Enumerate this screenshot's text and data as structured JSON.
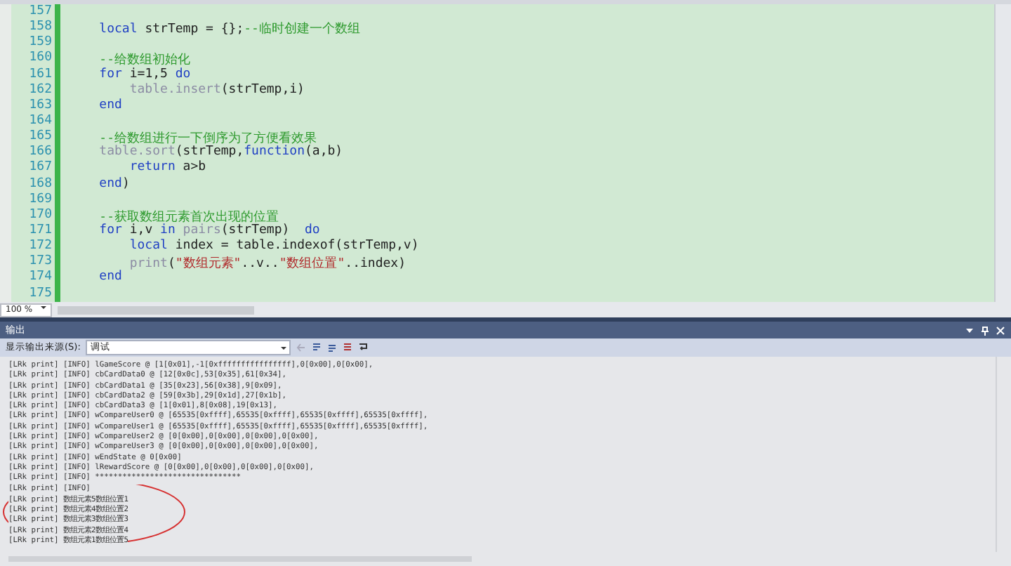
{
  "editor": {
    "lines": [
      {
        "number": "157"
      },
      {
        "number": "158",
        "tokens": [
          {
            "kind": "kw",
            "text": "    local"
          },
          {
            "kind": "plain",
            "text": " strTemp = {};"
          },
          {
            "kind": "comment",
            "text": "--临时创建一个数组"
          }
        ]
      },
      {
        "number": "159"
      },
      {
        "number": "160",
        "tokens": [
          {
            "kind": "comment",
            "text": "    --给数组初始化"
          }
        ]
      },
      {
        "number": "161",
        "tokens": [
          {
            "kind": "kw",
            "text": "    for"
          },
          {
            "kind": "plain",
            "text": " i=1,5 "
          },
          {
            "kind": "kw",
            "text": "do"
          }
        ]
      },
      {
        "number": "162",
        "tokens": [
          {
            "kind": "lib",
            "text": "        table.insert"
          },
          {
            "kind": "plain",
            "text": "(strTemp,i)"
          }
        ]
      },
      {
        "number": "163",
        "tokens": [
          {
            "kind": "kw",
            "text": "    end"
          }
        ]
      },
      {
        "number": "164"
      },
      {
        "number": "165",
        "tokens": [
          {
            "kind": "comment",
            "text": "    --给数组进行一下倒序为了方便看效果"
          }
        ]
      },
      {
        "number": "166",
        "tokens": [
          {
            "kind": "lib",
            "text": "    table.sort"
          },
          {
            "kind": "plain",
            "text": "(strTemp,"
          },
          {
            "kind": "kw",
            "text": "function"
          },
          {
            "kind": "plain",
            "text": "(a,b)"
          }
        ]
      },
      {
        "number": "167",
        "tokens": [
          {
            "kind": "kw",
            "text": "        return"
          },
          {
            "kind": "plain",
            "text": " a>b"
          }
        ]
      },
      {
        "number": "168",
        "tokens": [
          {
            "kind": "kw",
            "text": "    end"
          },
          {
            "kind": "plain",
            "text": ")"
          }
        ]
      },
      {
        "number": "169"
      },
      {
        "number": "170",
        "tokens": [
          {
            "kind": "comment",
            "text": "    --获取数组元素首次出现的位置"
          }
        ]
      },
      {
        "number": "171",
        "tokens": [
          {
            "kind": "kw",
            "text": "    for"
          },
          {
            "kind": "plain",
            "text": " i,v "
          },
          {
            "kind": "kw",
            "text": "in"
          },
          {
            "kind": "lib",
            "text": " pairs"
          },
          {
            "kind": "plain",
            "text": "(strTemp)  "
          },
          {
            "kind": "kw",
            "text": "do"
          }
        ]
      },
      {
        "number": "172",
        "tokens": [
          {
            "kind": "kw",
            "text": "        local"
          },
          {
            "kind": "plain",
            "text": " index = table.indexof(strTemp,v)"
          }
        ]
      },
      {
        "number": "173",
        "tokens": [
          {
            "kind": "lib",
            "text": "        print"
          },
          {
            "kind": "plain",
            "text": "("
          },
          {
            "kind": "str",
            "text": "\"数组元素\""
          },
          {
            "kind": "plain",
            "text": "..v.."
          },
          {
            "kind": "str",
            "text": "\"数组位置\""
          },
          {
            "kind": "plain",
            "text": "..index)"
          }
        ]
      },
      {
        "number": "174",
        "tokens": [
          {
            "kind": "kw",
            "text": "    end"
          }
        ]
      },
      {
        "number": "175"
      }
    ],
    "zoom": "100 %"
  },
  "output": {
    "title": "输出",
    "source_label": "显示输出来源(S):",
    "source_value": "调试",
    "lines": [
      "[LRk print] [INFO] lGameScore @ [1[0x01],-1[0xffffffffffffffff],0[0x00],0[0x00],",
      "[LRk print] [INFO] cbCardData0 @ [12[0x0c],53[0x35],61[0x34],",
      "[LRk print] [INFO] cbCardData1 @ [35[0x23],56[0x38],9[0x09],",
      "[LRk print] [INFO] cbCardData2 @ [59[0x3b],29[0x1d],27[0x1b],",
      "[LRk print] [INFO] cbCardData3 @ [1[0x01],8[0x08],19[0x13],",
      "[LRk print] [INFO] wCompareUser0 @ [65535[0xffff],65535[0xffff],65535[0xffff],65535[0xffff],",
      "[LRk print] [INFO] wCompareUser1 @ [65535[0xffff],65535[0xffff],65535[0xffff],65535[0xffff],",
      "[LRk print] [INFO] wCompareUser2 @ [0[0x00],0[0x00],0[0x00],0[0x00],",
      "[LRk print] [INFO] wCompareUser3 @ [0[0x00],0[0x00],0[0x00],0[0x00],",
      "[LRk print] [INFO] wEndState @ 0[0x00]",
      "[LRk print] [INFO] lRewardScore @ [0[0x00],0[0x00],0[0x00],0[0x00],",
      "[LRk print] [INFO] ********************************",
      "[LRk print] [INFO]",
      "[LRk print] 数组元素5数组位置1",
      "[LRk print] 数组元素4数组位置2",
      "[LRk print] 数组元素3数组位置3",
      "[LRk print] 数组元素2数组位置4",
      "[LRk print] 数组元素1数组位置5"
    ]
  }
}
